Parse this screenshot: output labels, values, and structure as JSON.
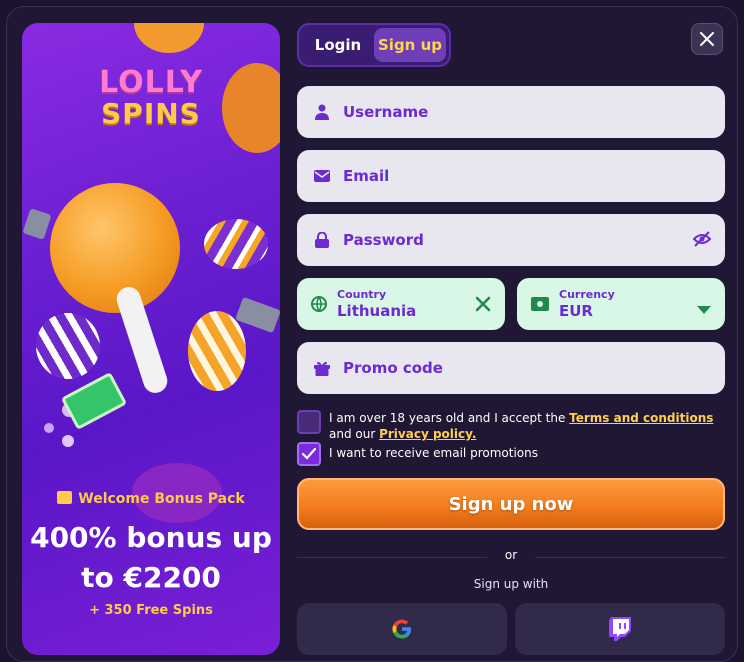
{
  "brand": {
    "logo_line1": "LOLLY",
    "logo_line2": "SPINS"
  },
  "promo": {
    "label": "Welcome Bonus Pack",
    "headline_line1": "400% bonus up",
    "headline_line2": "to €2200",
    "sub": "+ 350 Free Spins"
  },
  "tabs": [
    {
      "label": "Login",
      "active": false
    },
    {
      "label": "Sign up",
      "active": true
    }
  ],
  "form": {
    "username_placeholder": "Username",
    "email_placeholder": "Email",
    "password_placeholder": "Password",
    "country": {
      "label": "Country",
      "value": "Lithuania"
    },
    "currency": {
      "label": "Currency",
      "value": "EUR"
    },
    "promo_placeholder": "Promo code",
    "age_check": {
      "checked": false,
      "text_before": "I am over 18 years old and I accept the ",
      "terms_link": "Terms and conditions",
      "text_middle": " and our ",
      "privacy_link": "Privacy policy."
    },
    "email_promos": {
      "checked": true,
      "text": "I want to receive email promotions"
    },
    "submit_label": "Sign up now",
    "or_label": "or",
    "social_label": "Sign up with"
  },
  "colors": {
    "accent": "#6d2ad0",
    "button": "#f07a1c",
    "link": "#ffcf4d",
    "valid": "#d9f7e6"
  },
  "icons": [
    "user-icon",
    "mail-icon",
    "lock-icon",
    "eye-off-icon",
    "globe-icon",
    "clear-x-icon",
    "cash-icon",
    "chevron-down-icon",
    "gift-icon",
    "google-icon",
    "twitch-icon",
    "close-icon"
  ]
}
